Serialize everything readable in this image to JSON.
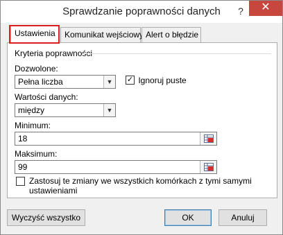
{
  "window": {
    "title": "Sprawdzanie poprawności danych",
    "help_glyph": "?",
    "close_glyph": "✕"
  },
  "tabs": [
    {
      "label": "Ustawienia",
      "active": true
    },
    {
      "label": "Komunikat wejściowy",
      "active": false
    },
    {
      "label": "Alert o błędzie",
      "active": false
    }
  ],
  "criteria": {
    "group_label": "Kryteria poprawności",
    "allow_label": "Dozwolone:",
    "allow_value": "Pełna liczba",
    "ignore_blank_label": "Ignoruj puste",
    "ignore_blank_checked": true,
    "data_label": "Wartości danych:",
    "data_value": "między",
    "minimum_label": "Minimum:",
    "minimum_value": "18",
    "maximum_label": "Maksimum:",
    "maximum_value": "99",
    "apply_all_label": "Zastosuj te zmiany we wszystkich komórkach z tymi samymi ustawieniami",
    "apply_all_checked": false
  },
  "buttons": {
    "clear_all": "Wyczyść wszystko",
    "ok": "OK",
    "cancel": "Anuluj"
  },
  "colors": {
    "close_button": "#c7463d",
    "tab_highlight": "#d8201f"
  }
}
